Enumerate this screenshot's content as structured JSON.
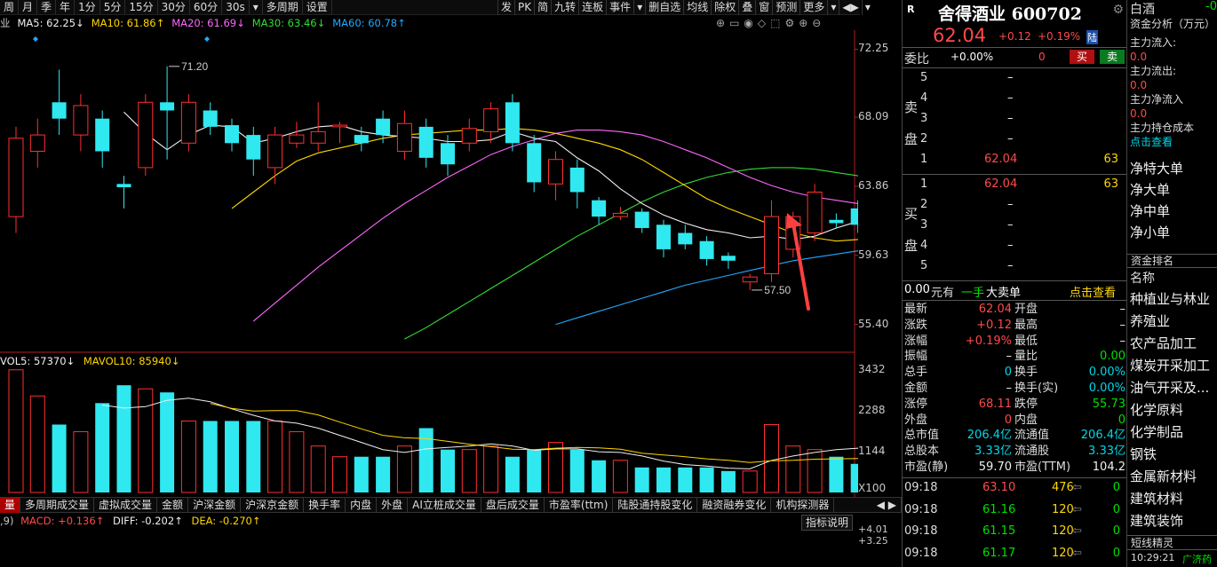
{
  "toolbar": {
    "left": [
      "周",
      "月",
      "季",
      "年",
      "1分",
      "5分",
      "15分",
      "30分",
      "60分",
      "30s",
      "▾",
      "多周期",
      "设置"
    ],
    "right": [
      "发",
      "PK",
      "简",
      "九转",
      "连板",
      "事件",
      "▾",
      "删自选",
      "均线",
      "除权",
      "叠",
      "窗",
      "预测",
      "更多",
      "▾",
      "◀▶",
      "▾"
    ]
  },
  "ma_legend": [
    {
      "label": "业",
      "color": "#c8c8c8"
    },
    {
      "label": "MA5: 62.25↓",
      "color": "#f0f0f0"
    },
    {
      "label": "MA10: 61.86↑",
      "color": "#ffd700"
    },
    {
      "label": "MA20: 61.69↓",
      "color": "#ff66ff"
    },
    {
      "label": "MA30: 63.46↓",
      "color": "#33dd33"
    },
    {
      "label": "MA60: 60.78↑",
      "color": "#22aaff"
    }
  ],
  "chart_tools": [
    "⊕",
    "▭",
    "◉",
    "◇",
    "⬚",
    "⚙",
    "⊕",
    "⊖"
  ],
  "price_axis": [
    "72.25",
    "68.09",
    "63.86",
    "59.63",
    "55.40"
  ],
  "annotations": {
    "high": "71.20",
    "low": "57.50"
  },
  "vol_legend": {
    "vol": "VOL5: 57370↓",
    "mavol": "MAVOL10: 85940↓"
  },
  "vol_axis": [
    "3432",
    "2288",
    "1144",
    "X100"
  ],
  "ind_tabs": [
    "量",
    "多周期成交量",
    "虚拟成交量",
    "金额",
    "沪深金额",
    "沪深京金额",
    "换手率",
    "内盘",
    "外盘",
    "AI立桩成交量",
    "盘后成交量",
    "市盈率(ttm)",
    "陆股通持股变化",
    "融资融券变化",
    "机构探测器"
  ],
  "macd_legend": {
    "prefix": ",9)",
    "macd": "MACD: +0.136↑",
    "diff": "DIFF: -0.202↑",
    "dea": "DEA: -0.270↑"
  },
  "macd_axis": [
    "+4.01",
    "+3.25"
  ],
  "ind_help": "指标说明",
  "stock": {
    "badge": "R",
    "name": "舍得酒业 600702",
    "price": "62.04",
    "change": "+0.12",
    "pct": "+0.19%",
    "tag": "陆"
  },
  "weibi": {
    "label": "委比",
    "value": "+0.00%",
    "diff": "0",
    "sell_btn": "买",
    "buy_btn": "卖"
  },
  "asks": [
    {
      "lvl": "5",
      "price": "–",
      "vol": ""
    },
    {
      "lvl": "4",
      "price": "–",
      "vol": ""
    },
    {
      "lvl": "3",
      "price": "–",
      "vol": ""
    },
    {
      "lvl": "2",
      "price": "–",
      "vol": ""
    },
    {
      "lvl": "1",
      "price": "62.04",
      "vol": "63"
    }
  ],
  "ask_side": [
    "卖",
    "盘"
  ],
  "bids": [
    {
      "lvl": "1",
      "price": "62.04",
      "vol": "63"
    },
    {
      "lvl": "2",
      "price": "–",
      "vol": ""
    },
    {
      "lvl": "3",
      "price": "–",
      "vol": ""
    },
    {
      "lvl": "4",
      "price": "–",
      "vol": ""
    },
    {
      "lvl": "5",
      "price": "–",
      "vol": ""
    }
  ],
  "bid_side": [
    "买",
    "盘"
  ],
  "big_order": {
    "amount": "0.00",
    "unit": "元有",
    "hands": "一手",
    "label": "大卖单",
    "link": "点击查看"
  },
  "stats": [
    {
      "l": "最新",
      "lv": "62.04",
      "lc": "red",
      "r": "开盘",
      "rv": "–",
      "rc": "white"
    },
    {
      "l": "涨跌",
      "lv": "+0.12",
      "lc": "red",
      "r": "最高",
      "rv": "–",
      "rc": "white"
    },
    {
      "l": "涨幅",
      "lv": "+0.19%",
      "lc": "red",
      "r": "最低",
      "rv": "–",
      "rc": "white"
    },
    {
      "l": "振幅",
      "lv": "–",
      "lc": "white",
      "r": "量比",
      "rv": "0.00",
      "rc": "green"
    },
    {
      "l": "总手",
      "lv": "0",
      "lc": "cyan",
      "r": "换手",
      "rv": "0.00%",
      "rc": "cyan"
    },
    {
      "l": "金额",
      "lv": "–",
      "lc": "white",
      "r": "换手(实)",
      "rv": "0.00%",
      "rc": "cyan"
    },
    {
      "l": "涨停",
      "lv": "68.11",
      "lc": "red",
      "r": "跌停",
      "rv": "55.73",
      "rc": "green"
    },
    {
      "l": "外盘",
      "lv": "0",
      "lc": "red",
      "r": "内盘",
      "rv": "0",
      "rc": "green"
    },
    {
      "l": "总市值",
      "lv": "206.4亿",
      "lc": "cyan",
      "r": "流通值",
      "rv": "206.4亿",
      "rc": "cyan"
    },
    {
      "l": "总股本",
      "lv": "3.33亿",
      "lc": "cyan",
      "r": "流通股",
      "rv": "3.33亿",
      "rc": "cyan"
    },
    {
      "l": "市盈(静)",
      "lv": "59.70",
      "lc": "white",
      "r": "市盈(TTM)",
      "rv": "104.2",
      "rc": "white"
    }
  ],
  "ticks": [
    {
      "t": "09:18",
      "p": "63.10",
      "pc": "red",
      "v": "476",
      "d": "0"
    },
    {
      "t": "09:18",
      "p": "61.16",
      "pc": "green",
      "v": "120",
      "d": "0"
    },
    {
      "t": "09:18",
      "p": "61.15",
      "pc": "green",
      "v": "120",
      "d": "0"
    },
    {
      "t": "09:18",
      "p": "61.17",
      "pc": "green",
      "v": "120",
      "d": "0"
    }
  ],
  "fund": {
    "title": "白酒",
    "title_val": "-0",
    "subtitle": "资金分析（万元）",
    "items": [
      {
        "k": "主力流入:",
        "v": "0.0"
      },
      {
        "k": "主力流出:",
        "v": "0.0"
      },
      {
        "k": "主力净流入",
        "v": "0.0"
      },
      {
        "k": "主力持仓成本",
        "v": "点击查看"
      }
    ],
    "net": [
      "净特大单",
      "净大单",
      "净中单",
      "净小单"
    ],
    "rank_title": "资金排名",
    "rank_header": "名称",
    "rank": [
      "种植业与林业",
      "养殖业",
      "农产品加工",
      "煤炭开采加工",
      "油气开采及...",
      "化学原料",
      "化学制品",
      "钢铁",
      "金属新材料",
      "建筑材料",
      "建筑装饰"
    ],
    "footer": "短线精灵",
    "footer_time": "10:29:21",
    "footer_tag": "广济药"
  },
  "chart_data": {
    "type": "candlestick",
    "ylim": [
      53.8,
      73.2
    ],
    "candles": [
      {
        "o": 62.0,
        "c": 66.8,
        "h": 67.5,
        "l": 61.0
      },
      {
        "o": 66.0,
        "c": 67.0,
        "h": 68.0,
        "l": 65.0
      },
      {
        "o": 69.0,
        "c": 68.0,
        "h": 71.0,
        "l": 67.0
      },
      {
        "o": 67.0,
        "c": 68.8,
        "h": 69.5,
        "l": 66.0
      },
      {
        "o": 68.0,
        "c": 66.0,
        "h": 68.5,
        "l": 65.0
      },
      {
        "o": 64.0,
        "c": 63.8,
        "h": 64.5,
        "l": 62.5
      },
      {
        "o": 65.0,
        "c": 69.0,
        "h": 69.5,
        "l": 64.5
      },
      {
        "o": 69.0,
        "c": 68.5,
        "h": 71.2,
        "l": 65.5
      },
      {
        "o": 66.5,
        "c": 69.0,
        "h": 69.5,
        "l": 66.0
      },
      {
        "o": 68.5,
        "c": 67.5,
        "h": 69.0,
        "l": 67.0
      },
      {
        "o": 67.6,
        "c": 66.5,
        "h": 68.0,
        "l": 66.0
      },
      {
        "o": 67.0,
        "c": 65.5,
        "h": 67.5,
        "l": 64.5
      },
      {
        "o": 65.0,
        "c": 67.0,
        "h": 67.5,
        "l": 64.0
      },
      {
        "o": 66.5,
        "c": 67.0,
        "h": 67.8,
        "l": 66.2
      },
      {
        "o": 66.5,
        "c": 67.2,
        "h": 69.0,
        "l": 66.0
      },
      {
        "o": 67.5,
        "c": 67.6,
        "h": 67.8,
        "l": 66.5
      },
      {
        "o": 67.0,
        "c": 66.5,
        "h": 67.5,
        "l": 66.0
      },
      {
        "o": 68.0,
        "c": 67.0,
        "h": 68.5,
        "l": 66.5
      },
      {
        "o": 66.0,
        "c": 67.7,
        "h": 68.5,
        "l": 65.5
      },
      {
        "o": 67.5,
        "c": 65.6,
        "h": 68.0,
        "l": 65.0
      },
      {
        "o": 66.5,
        "c": 65.2,
        "h": 67.0,
        "l": 64.5
      },
      {
        "o": 66.5,
        "c": 67.4,
        "h": 68.0,
        "l": 66.0
      },
      {
        "o": 67.2,
        "c": 68.6,
        "h": 69.0,
        "l": 66.5
      },
      {
        "o": 69.0,
        "c": 66.5,
        "h": 69.5,
        "l": 66.0
      },
      {
        "o": 66.5,
        "c": 64.1,
        "h": 67.0,
        "l": 63.5
      },
      {
        "o": 64.0,
        "c": 65.5,
        "h": 66.0,
        "l": 63.0
      },
      {
        "o": 65.0,
        "c": 63.5,
        "h": 65.5,
        "l": 62.5
      },
      {
        "o": 63.0,
        "c": 62.0,
        "h": 63.2,
        "l": 61.5
      },
      {
        "o": 62.0,
        "c": 62.2,
        "h": 62.6,
        "l": 61.8
      },
      {
        "o": 62.3,
        "c": 61.3,
        "h": 62.5,
        "l": 61.0
      },
      {
        "o": 61.5,
        "c": 60.0,
        "h": 61.8,
        "l": 59.5
      },
      {
        "o": 61.0,
        "c": 60.3,
        "h": 61.5,
        "l": 60.0
      },
      {
        "o": 60.5,
        "c": 59.4,
        "h": 60.8,
        "l": 59.0
      },
      {
        "o": 59.6,
        "c": 59.3,
        "h": 59.8,
        "l": 58.8
      },
      {
        "o": 58.0,
        "c": 58.3,
        "h": 58.5,
        "l": 57.5
      },
      {
        "o": 58.5,
        "c": 62.0,
        "h": 63.0,
        "l": 58.0
      },
      {
        "o": 60.0,
        "c": 62.0,
        "h": 62.3,
        "l": 59.5
      },
      {
        "o": 61.0,
        "c": 63.5,
        "h": 64.0,
        "l": 60.5
      },
      {
        "o": 61.8,
        "c": 61.6,
        "h": 62.2,
        "l": 61.3
      },
      {
        "o": 62.5,
        "c": 61.5,
        "h": 63.0,
        "l": 61.0
      },
      {
        "o": 61.5,
        "c": 62.5,
        "h": 63.0,
        "l": 61.0
      },
      {
        "o": 62.5,
        "c": 61.5,
        "h": 63.0,
        "l": 61.0
      },
      {
        "o": 61.5,
        "c": 62.4,
        "h": 64.0,
        "l": 61.0
      },
      {
        "o": 62.3,
        "c": 62.0,
        "h": 62.5,
        "l": 61.5
      },
      {
        "o": 62.5,
        "c": 62.5,
        "h": 62.5,
        "l": 62.0
      }
    ],
    "ma5": [
      68.4,
      67.1,
      66.1,
      67.0,
      67.6,
      67.5,
      66.5,
      66.8,
      67.2,
      67.5,
      67.6,
      67.2,
      67.0,
      66.9,
      66.8,
      66.6,
      66.6,
      66.7,
      67.2,
      66.8,
      66.6,
      65.6,
      64.8,
      63.7,
      62.8,
      62.1,
      61.6,
      61.2,
      61.0,
      60.7,
      60.8,
      60.6,
      60.8,
      61.3,
      61.7,
      61.8,
      62.1,
      62.2,
      62.2,
      62.2
    ],
    "ma10": [
      62.5,
      63.5,
      64.5,
      65.4,
      65.9,
      66.2,
      66.5,
      66.8,
      67.0,
      67.1,
      67.2,
      67.3,
      67.3,
      67.4,
      67.3,
      67.1,
      66.8,
      66.5,
      66.1,
      65.5,
      64.7,
      63.9,
      63.1,
      62.5,
      62.0,
      61.5,
      61.0,
      60.7,
      60.5,
      60.6,
      60.8,
      61.1,
      61.4,
      61.7,
      61.9
    ],
    "ma20": [
      55.6,
      56.7,
      57.8,
      58.9,
      59.9,
      60.9,
      61.9,
      62.8,
      63.6,
      64.4,
      65.1,
      65.8,
      66.3,
      66.7,
      67.1,
      67.3,
      67.3,
      67.2,
      67.0,
      66.6,
      66.1,
      65.6,
      65.0,
      64.4,
      63.9,
      63.5,
      63.2,
      63.0,
      62.8,
      62.6,
      62.5,
      62.4,
      62.3,
      62.2
    ],
    "ma30": [
      54.5,
      55.2,
      56.0,
      56.8,
      57.6,
      58.4,
      59.2,
      60.0,
      60.8,
      61.5,
      62.2,
      62.9,
      63.5,
      64.0,
      64.4,
      64.7,
      64.9,
      65.0,
      65.0,
      64.9,
      64.7,
      64.5,
      64.2,
      64.0,
      63.8,
      63.6,
      63.5
    ],
    "ma60": [
      55.4,
      55.8,
      56.2,
      56.6,
      57.0,
      57.4,
      57.8,
      58.1,
      58.4,
      58.7,
      59.0,
      59.3,
      59.5,
      59.7,
      59.9,
      60.1,
      60.3,
      60.5,
      60.7,
      60.8
    ],
    "volumes": [
      3432,
      2700,
      1900,
      1700,
      2500,
      3000,
      2900,
      2800,
      2000,
      2000,
      2000,
      2000,
      2000,
      1700,
      1300,
      1000,
      1000,
      1000,
      1300,
      1800,
      1200,
      1200,
      1300,
      1000,
      1200,
      1400,
      1200,
      900,
      900,
      700,
      700,
      700,
      700,
      600,
      600,
      1900,
      1300,
      1200,
      1000,
      800,
      800,
      800,
      800,
      800,
      800
    ],
    "vol_ylim": [
      0,
      3600
    ]
  }
}
